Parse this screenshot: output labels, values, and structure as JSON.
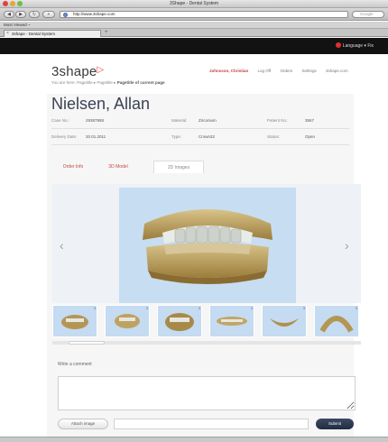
{
  "window": {
    "title": "3Shape - Dental System"
  },
  "browser": {
    "url": "http://www.3shape.com",
    "search_placeholder": "Google",
    "bookmarks_label": "Most Viewed ~",
    "tab_label": "3shape - Dental System"
  },
  "topbar": {
    "language": "Language ▾  Fix"
  },
  "header": {
    "logo_text": "3shape",
    "user": "Johnsson, Christian",
    "nav": [
      "Log Off",
      "Orders",
      "Settings",
      "3shape.com"
    ]
  },
  "breadcrumb": {
    "prefix": "You are here:",
    "path": "Pagetitle ▸ Pagetitle ▸",
    "current": "Pagetitle of current page"
  },
  "patient": {
    "name": "Nielsen, Allan"
  },
  "fields": {
    "case_no_label": "Case No.:",
    "case_no": "29387958",
    "material_label": "Material:",
    "material": "Zirconium",
    "patient_no_label": "Patient No.:",
    "patient_no": "3567",
    "delivery_label": "Delivery Date:",
    "delivery": "20.01.2011",
    "type_label": "Type:",
    "type": "Crown32",
    "status_label": "Status:",
    "status": "Open"
  },
  "tabs": {
    "order_info": "Order Info",
    "model_3d": "3D Model",
    "images": "2D Images"
  },
  "viewer": {
    "prev": "‹",
    "next": "›",
    "thumb_badges": [
      "3",
      "3",
      "3",
      "3",
      "3",
      "3"
    ]
  },
  "comment": {
    "label": "Write a comment",
    "attach": "Attach image",
    "submit": "Submit"
  },
  "colors": {
    "accent": "#c54040",
    "logo_mark": "#e2483f",
    "submit": "#2b344b",
    "viewer_bg": "#c7ddf2"
  }
}
